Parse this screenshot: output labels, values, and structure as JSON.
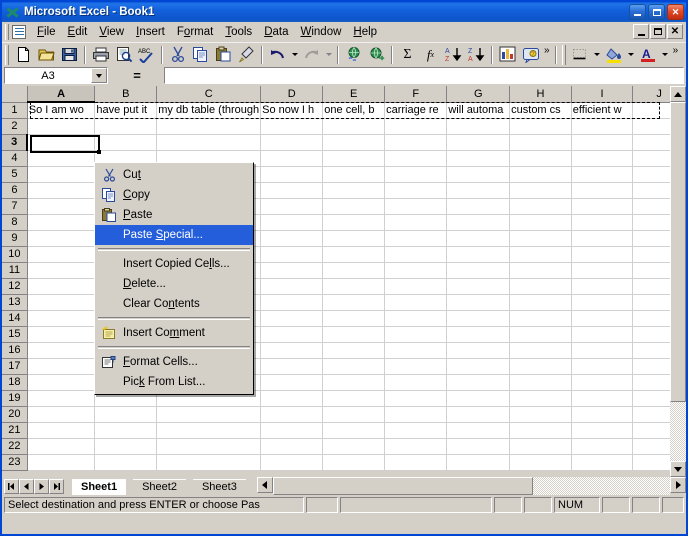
{
  "window": {
    "title": "Microsoft Excel - Book1",
    "app_icon": "excel-x-icon",
    "minimize_label": "",
    "maximize_label": "",
    "close_label": "✕",
    "mdi_minimize": "_",
    "mdi_restore": "❐",
    "mdi_close": "✕"
  },
  "menubar": {
    "items": [
      {
        "label": "File"
      },
      {
        "label": "Edit"
      },
      {
        "label": "View"
      },
      {
        "label": "Insert"
      },
      {
        "label": "Format"
      },
      {
        "label": "Tools"
      },
      {
        "label": "Data"
      },
      {
        "label": "Window"
      },
      {
        "label": "Help"
      }
    ]
  },
  "toolbar": {
    "standard": [
      {
        "name": "new-icon",
        "label": "New"
      },
      {
        "name": "open-icon",
        "label": "Open"
      },
      {
        "name": "save-icon",
        "label": "Save"
      },
      {
        "name": "print-icon",
        "label": "Print"
      },
      {
        "name": "print-preview-icon",
        "label": "Print Preview"
      },
      {
        "name": "spelling-icon",
        "label": "Spelling"
      },
      {
        "name": "cut-icon",
        "label": "Cut"
      },
      {
        "name": "copy-icon",
        "label": "Copy"
      },
      {
        "name": "paste-icon",
        "label": "Paste"
      },
      {
        "name": "format-painter-icon",
        "label": "Format Painter"
      },
      {
        "name": "undo-icon",
        "label": "Undo"
      },
      {
        "name": "redo-icon",
        "label": "Redo"
      },
      {
        "name": "insert-hyperlink-icon",
        "label": "Insert Hyperlink"
      },
      {
        "name": "web-toolbar-icon",
        "label": "Web Toolbar"
      },
      {
        "name": "autosum-icon",
        "label": "AutoSum"
      },
      {
        "name": "paste-function-icon",
        "label": "Paste Function"
      },
      {
        "name": "sort-ascending-icon",
        "label": "Sort Ascending"
      },
      {
        "name": "sort-descending-icon",
        "label": "Sort Descending"
      },
      {
        "name": "chart-wizard-icon",
        "label": "Chart Wizard"
      },
      {
        "name": "office-assistant-icon",
        "label": "Office Assistant"
      }
    ],
    "formatting": [
      {
        "name": "borders-icon",
        "label": "Borders"
      },
      {
        "name": "fill-color-icon",
        "label": "Fill Color"
      },
      {
        "name": "font-color-icon",
        "label": "Font Color"
      }
    ],
    "overflow_label": "»"
  },
  "formulabar": {
    "name_box_value": "A3",
    "equals_label": "=",
    "formula_value": ""
  },
  "grid": {
    "columns": [
      "A",
      "B",
      "C",
      "D",
      "E",
      "F",
      "G",
      "H",
      "I",
      "J"
    ],
    "selected_column": "A",
    "selected_row": 3,
    "rows": [
      1,
      2,
      3,
      4,
      5,
      6,
      7,
      8,
      9,
      10,
      11,
      12,
      13,
      14,
      15,
      16,
      17,
      18,
      19,
      20,
      21,
      22,
      23
    ],
    "row1_values": [
      "So I am wo",
      "have put it",
      "my db table (through",
      "So now I h",
      "one cell, b",
      "carriage re",
      "will automa",
      "custom cs",
      "efficient w",
      ""
    ],
    "active_cell": "A3"
  },
  "context_menu": {
    "items": [
      {
        "label": "Cut",
        "icon": "scissors-icon",
        "accel": "t",
        "highlighted": false,
        "separator_after": false
      },
      {
        "label": "Copy",
        "icon": "copy-documents-icon",
        "accel": "C",
        "highlighted": false,
        "separator_after": false
      },
      {
        "label": "Paste",
        "icon": "clipboard-icon",
        "accel": "P",
        "highlighted": false,
        "separator_after": false
      },
      {
        "label": "Paste Special...",
        "icon": "none",
        "accel": "S",
        "highlighted": true,
        "separator_after": true
      },
      {
        "label": "Insert Copied Cells...",
        "icon": "none",
        "accel": "l",
        "highlighted": false,
        "separator_after": false
      },
      {
        "label": "Delete...",
        "icon": "none",
        "accel": "D",
        "highlighted": false,
        "separator_after": false
      },
      {
        "label": "Clear Contents",
        "icon": "none",
        "accel": "n",
        "highlighted": false,
        "separator_after": true
      },
      {
        "label": "Insert Comment",
        "icon": "comment-note-icon",
        "accel": "m",
        "highlighted": false,
        "separator_after": true
      },
      {
        "label": "Format Cells...",
        "icon": "format-cells-icon",
        "accel": "F",
        "highlighted": false,
        "separator_after": false
      },
      {
        "label": "Pick From List...",
        "icon": "none",
        "accel": "k",
        "highlighted": false,
        "separator_after": false
      }
    ]
  },
  "sheet_tabs": {
    "nav_first": "|◀",
    "nav_prev": "◀",
    "nav_next": "▶",
    "nav_last": "▶|",
    "tabs": [
      {
        "label": "Sheet1",
        "active": true
      },
      {
        "label": "Sheet2",
        "active": false
      },
      {
        "label": "Sheet3",
        "active": false
      }
    ]
  },
  "statusbar": {
    "message": "Select destination and press ENTER or choose Pas",
    "num_lock": "NUM"
  },
  "colors": {
    "title_blue": "#0a56d6",
    "menu_highlight": "#245edb",
    "face": "#d4d0c8",
    "grid_line": "#d0d0d0",
    "window_border": "#0046d5"
  }
}
